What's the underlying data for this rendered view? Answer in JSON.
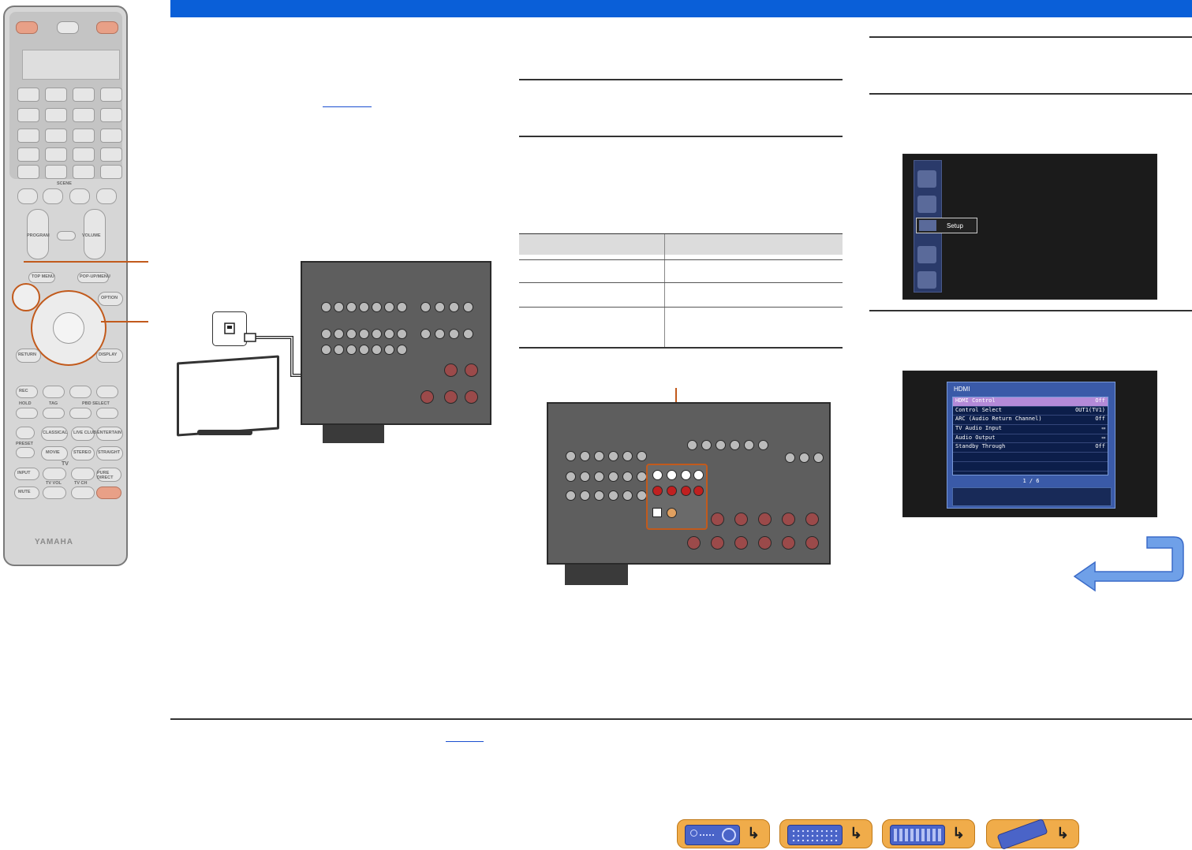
{
  "remote": {
    "scene_label": "SCENE",
    "program_label": "PROGRAM",
    "volume_label": "VOLUME",
    "top_menu": "TOP MENU",
    "popup_menu": "POP-UP/MENU",
    "option": "OPTION",
    "return": "RETURN",
    "display": "DISPLAY",
    "rec": "REC",
    "hold": "HOLD",
    "tag": "TAG",
    "pbd_select": "PBD SELECT",
    "classical": "CLASSICAL",
    "live_club": "LIVE CLUB",
    "entertain": "ENTERTAIN",
    "movie": "MOVIE",
    "stereo": "STEREO",
    "straight": "STRAIGHT",
    "preset": "PRESET",
    "tv_label": "TV",
    "input": "INPUT",
    "tv_vol": "TV VOL",
    "tv_ch": "TV CH",
    "pure_direct": "PURE DIRECT",
    "mute": "MUTE",
    "brand": "YAMAHA"
  },
  "setup_screen": {
    "menu_label": "Setup"
  },
  "hdmi_screen": {
    "title": "HDMI",
    "rows": [
      {
        "label": "HDMI Control",
        "value": "Off"
      },
      {
        "label": "Control Select",
        "value": "OUT1(TV1)"
      },
      {
        "label": "ARC (Audio Return Channel)",
        "value": "Off"
      },
      {
        "label": "TV Audio Input",
        "value": "▭"
      },
      {
        "label": "Audio Output",
        "value": "▭"
      },
      {
        "label": "Standby Through",
        "value": "Off"
      }
    ],
    "page": "1 / 6"
  },
  "nav_icons": [
    "receiver-front-icon",
    "receiver-rear-icon",
    "front-display-icon",
    "remote-control-icon"
  ]
}
